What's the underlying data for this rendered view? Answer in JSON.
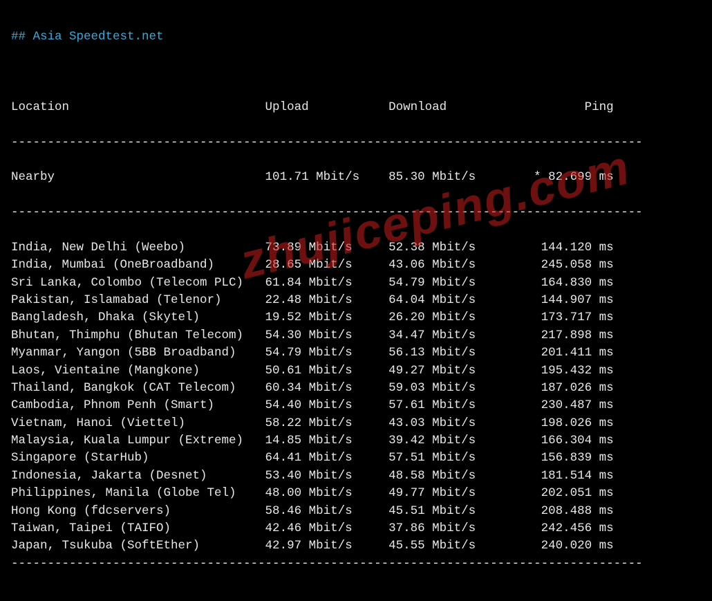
{
  "title": "## Asia Speedtest.net",
  "columns": {
    "location": "Location",
    "upload": "Upload",
    "download": "Download",
    "ping": "Ping"
  },
  "nearby": {
    "label": "Nearby",
    "upload": "101.71 Mbit/s",
    "download": "85.30 Mbit/s",
    "ping": "* 82.699 ms"
  },
  "rows": [
    {
      "location": "India, New Delhi (Weebo)",
      "upload": "73.89 Mbit/s",
      "download": "52.38 Mbit/s",
      "ping": "144.120 ms"
    },
    {
      "location": "India, Mumbai (OneBroadband)",
      "upload": "28.65 Mbit/s",
      "download": "43.06 Mbit/s",
      "ping": "245.058 ms"
    },
    {
      "location": "Sri Lanka, Colombo (Telecom PLC)",
      "upload": "61.84 Mbit/s",
      "download": "54.79 Mbit/s",
      "ping": "164.830 ms"
    },
    {
      "location": "Pakistan, Islamabad (Telenor)",
      "upload": "22.48 Mbit/s",
      "download": "64.04 Mbit/s",
      "ping": "144.907 ms"
    },
    {
      "location": "Bangladesh, Dhaka (Skytel)",
      "upload": "19.52 Mbit/s",
      "download": "26.20 Mbit/s",
      "ping": "173.717 ms"
    },
    {
      "location": "Bhutan, Thimphu (Bhutan Telecom)",
      "upload": "54.30 Mbit/s",
      "download": "34.47 Mbit/s",
      "ping": "217.898 ms"
    },
    {
      "location": "Myanmar, Yangon (5BB Broadband)",
      "upload": "54.79 Mbit/s",
      "download": "56.13 Mbit/s",
      "ping": "201.411 ms"
    },
    {
      "location": "Laos, Vientaine (Mangkone)",
      "upload": "50.61 Mbit/s",
      "download": "49.27 Mbit/s",
      "ping": "195.432 ms"
    },
    {
      "location": "Thailand, Bangkok (CAT Telecom)",
      "upload": "60.34 Mbit/s",
      "download": "59.03 Mbit/s",
      "ping": "187.026 ms"
    },
    {
      "location": "Cambodia, Phnom Penh (Smart)",
      "upload": "54.40 Mbit/s",
      "download": "57.61 Mbit/s",
      "ping": "230.487 ms"
    },
    {
      "location": "Vietnam, Hanoi (Viettel)",
      "upload": "58.22 Mbit/s",
      "download": "43.03 Mbit/s",
      "ping": "198.026 ms"
    },
    {
      "location": "Malaysia, Kuala Lumpur (Extreme)",
      "upload": "14.85 Mbit/s",
      "download": "39.42 Mbit/s",
      "ping": "166.304 ms"
    },
    {
      "location": "Singapore (StarHub)",
      "upload": "64.41 Mbit/s",
      "download": "57.51 Mbit/s",
      "ping": "156.839 ms"
    },
    {
      "location": "Indonesia, Jakarta (Desnet)",
      "upload": "53.40 Mbit/s",
      "download": "48.58 Mbit/s",
      "ping": "181.514 ms"
    },
    {
      "location": "Philippines, Manila (Globe Tel)",
      "upload": "48.00 Mbit/s",
      "download": "49.77 Mbit/s",
      "ping": "202.051 ms"
    },
    {
      "location": "Hong Kong (fdcservers)",
      "upload": "58.46 Mbit/s",
      "download": "45.51 Mbit/s",
      "ping": "208.488 ms"
    },
    {
      "location": "Taiwan, Taipei (TAIFO)",
      "upload": "42.46 Mbit/s",
      "download": "37.86 Mbit/s",
      "ping": "242.456 ms"
    },
    {
      "location": "Japan, Tsukuba (SoftEther)",
      "upload": "42.97 Mbit/s",
      "download": "45.55 Mbit/s",
      "ping": "240.020 ms"
    }
  ],
  "dash_line": "---------------------------------------------------------------------------------------",
  "layout": {
    "col1": 35,
    "col2": 17,
    "col3": 17,
    "col4": 14
  },
  "watermark": "zhujiceping.com",
  "chart_data": {
    "type": "table",
    "title": "Asia Speedtest.net",
    "columns": [
      "Location",
      "Upload (Mbit/s)",
      "Download (Mbit/s)",
      "Ping (ms)"
    ],
    "rows": [
      [
        "Nearby",
        101.71,
        85.3,
        82.699
      ],
      [
        "India, New Delhi (Weebo)",
        73.89,
        52.38,
        144.12
      ],
      [
        "India, Mumbai (OneBroadband)",
        28.65,
        43.06,
        245.058
      ],
      [
        "Sri Lanka, Colombo (Telecom PLC)",
        61.84,
        54.79,
        164.83
      ],
      [
        "Pakistan, Islamabad (Telenor)",
        22.48,
        64.04,
        144.907
      ],
      [
        "Bangladesh, Dhaka (Skytel)",
        19.52,
        26.2,
        173.717
      ],
      [
        "Bhutan, Thimphu (Bhutan Telecom)",
        54.3,
        34.47,
        217.898
      ],
      [
        "Myanmar, Yangon (5BB Broadband)",
        54.79,
        56.13,
        201.411
      ],
      [
        "Laos, Vientaine (Mangkone)",
        50.61,
        49.27,
        195.432
      ],
      [
        "Thailand, Bangkok (CAT Telecom)",
        60.34,
        59.03,
        187.026
      ],
      [
        "Cambodia, Phnom Penh (Smart)",
        54.4,
        57.61,
        230.487
      ],
      [
        "Vietnam, Hanoi (Viettel)",
        58.22,
        43.03,
        198.026
      ],
      [
        "Malaysia, Kuala Lumpur (Extreme)",
        14.85,
        39.42,
        166.304
      ],
      [
        "Singapore (StarHub)",
        64.41,
        57.51,
        156.839
      ],
      [
        "Indonesia, Jakarta (Desnet)",
        53.4,
        48.58,
        181.514
      ],
      [
        "Philippines, Manila (Globe Tel)",
        48.0,
        49.77,
        202.051
      ],
      [
        "Hong Kong (fdcservers)",
        58.46,
        45.51,
        208.488
      ],
      [
        "Taiwan, Taipei (TAIFO)",
        42.46,
        37.86,
        242.456
      ],
      [
        "Japan, Tsukuba (SoftEther)",
        42.97,
        45.55,
        240.02
      ]
    ]
  }
}
